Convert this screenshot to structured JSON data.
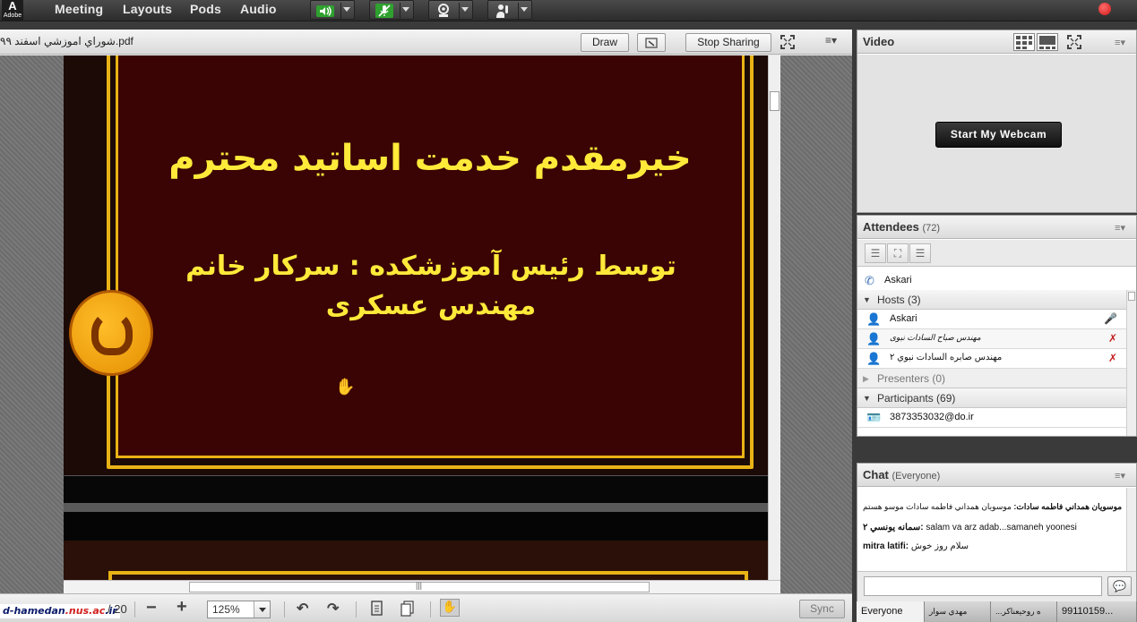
{
  "app": {
    "logo_glyph": "A",
    "logo_word": "Adobe"
  },
  "menu": [
    "Meeting",
    "Layouts",
    "Pods",
    "Audio"
  ],
  "toolbar": {
    "speaker_icon": "speaker-icon",
    "mic_icon": "microphone-muted-icon",
    "webcam_icon": "webcam-icon",
    "raise_hand_icon": "raise-hand-icon",
    "record_color": "#d01818"
  },
  "share": {
    "doc_name": "شوراي اموزشي اسفند ۹۹.pdf",
    "draw_label": "Draw",
    "stop_sharing_label": "Stop Sharing",
    "slide": {
      "title": "خیرمقدم خدمت اساتید محترم",
      "subtitle": "توسط رئیس آموزشکده : سرکار خانم مهندس عسکری",
      "title_color": "#ffea3a",
      "frame_color": "#e9b316",
      "background_color": "#3a0304"
    },
    "footer": {
      "watermark_left": "d-hamedan",
      "watermark_mid": ".nus.ac",
      "watermark_right": ".ir",
      "page_total": "20",
      "zoom": "125%",
      "sync_label": "Sync"
    }
  },
  "video": {
    "title": "Video",
    "webcam_button": "Start My Webcam"
  },
  "attendees": {
    "title": "Attendees",
    "count": "(72)",
    "me": "Askari",
    "hosts_label": "Hosts (3)",
    "hosts": [
      {
        "name": "Askari"
      },
      {
        "name": "مهندس صباح السادات نبوی"
      },
      {
        "name": "مهندس صابره السادات نبوي ۲"
      }
    ],
    "presenters_label": "Presenters (0)",
    "participants_label": "Participants (69)",
    "participants": [
      {
        "name": "3873353032@do.ir"
      }
    ]
  },
  "chat": {
    "title": "Chat",
    "audience": "(Everyone)",
    "messages": [
      {
        "sender": "موسويان همداني فاطمه سادات:",
        "text": " موسويان همداني فاطمه سادات موسو هستم"
      },
      {
        "sender": "سمانه يونسي ۲:",
        "text": " salam va arz adab...samaneh yoonesi"
      },
      {
        "sender": "mitra latifi:",
        "text": " سلام روز خوش"
      }
    ],
    "input_placeholder": "",
    "tabs": [
      "Everyone",
      "مهدي سوار",
      "...ه روحيعناكر",
      "99110159..."
    ]
  }
}
